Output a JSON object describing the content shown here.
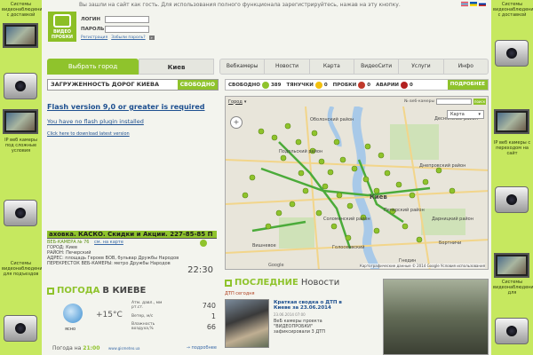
{
  "header": {
    "welcome": "Вы зашли на сайт как гость. Для использования полного функционала зарегистрируйтесь, нажав на эту кнопку.",
    "logo_text": "ВИДЕО ПРОБКИ",
    "login_label": "ЛОГИН",
    "password_label": "ПАРОЛЬ",
    "register_link": "Регистрация",
    "forgot_link": "Забыли пароль?",
    "go_glyph": "»",
    "languages": [
      "gb",
      "ua",
      "ru"
    ]
  },
  "nav": {
    "choose_city": "Выбрать город",
    "city": "Киев",
    "menu": [
      "Вебкамеры",
      "Новости",
      "Карта",
      "ВидеоСити",
      "Услуги",
      "Инфо"
    ]
  },
  "traffic": {
    "label": "ЗАГРУЖЕННОСТЬ ДОРОГ КИЕВА",
    "state": "СВОБОДНО"
  },
  "flash": {
    "title": "Flash version 9,0 or greater is required",
    "subtitle": "You have no flash plugin installed",
    "link": "Click here to download latest version"
  },
  "ad_strip": "аховка. КАСКО. Скидки и Акции. 227-85-85 П",
  "camera": {
    "header": "ВЕБ-КАМЕРА № 76",
    "map_link": "см. на карте",
    "lines": [
      "ГОРОД: Киев",
      "РАЙОН: Печерский",
      "АДРЕС: площадь Героев ВОВ, бульвар Дружбы Народов",
      "ПЕРЕКРЕСТОК ВЕБ-КАМЕРЫ: метро Дружбы Народов"
    ],
    "time": "22:30"
  },
  "weather": {
    "title": "ПОГОДА",
    "city": "В КИЕВЕ",
    "sky": "ясно",
    "temp": "+15°C",
    "params": [
      {
        "label": "Атм. давл., мм рт.ст.",
        "value": "740"
      },
      {
        "label": "Ветер, м/с",
        "value": "1"
      },
      {
        "label": "Влажность воздуха,%",
        "value": "66"
      }
    ],
    "forecast_prefix": "Погода на",
    "forecast_time": "21:00",
    "source": "www.gismeteo.ua",
    "more": "→ подробнее"
  },
  "status": {
    "free_label": "СВОБОДНО",
    "free_count": "389",
    "slow_label": "ТЯНУЧКИ",
    "slow_count": "0",
    "jam_label": "ПРОБКИ",
    "jam_count": "0",
    "accident_label": "АВАРИИ",
    "accident_count": "0",
    "more": "ПОДРОБНЕЕ",
    "colors": {
      "free": "#8fc32c",
      "slow": "#f3c10e",
      "jam": "#c0392b",
      "accident": "#b22020"
    }
  },
  "map": {
    "selector": "Город",
    "search_label": "№ веб-камеры",
    "find_button": "поиск",
    "type": "Карта",
    "zoom_glyph": "+",
    "google": "Google",
    "copyright": "Картографические данные © 2014 Google  Условия использования",
    "districts": [
      "Оболонский район",
      "Подольский район",
      "Киев",
      "Соломенский район",
      "Печерский район",
      "Днепровский район",
      "Дарницкий район",
      "Деснянский район",
      "Вишневое",
      "Голосеевский",
      "Бортничи",
      "Гнедин"
    ]
  },
  "news": {
    "title": "ПОСЛЕДНИЕ",
    "title_rest": "Новости",
    "category": "ДТП сегодня",
    "headline": "Краткая сводка о ДТП в Киеве за 23.06.2014",
    "date": "23.06.2014 07:00",
    "body": "ВеБ камеры проекта \"ВИДЕОПРОБКИ\" зафиксировали 3 ДТП"
  },
  "side_left": [
    "Системы видеонаблюдения с доставкой",
    "IP веб камеры с трансляцией на",
    "IP веб камеры под сложные условия",
    "Системы видеонаблюдения для подъездов"
  ],
  "side_right": [
    "Системы видеонаблюдения с доставкой",
    "IP веб камеры с трансляцией",
    "IP веб камеры с переходом на сайт",
    "Системы видеонаблюдения для"
  ]
}
